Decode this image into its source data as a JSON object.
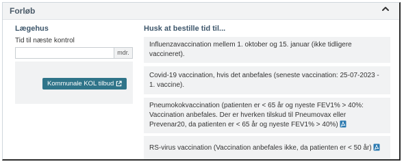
{
  "header": {
    "title": "Forløb",
    "collapse_icon": "chevron-up-icon"
  },
  "left": {
    "section_title": "Lægehus",
    "field_label": "Tid til næste kontrol",
    "input_value": "",
    "input_addon": "mdr.",
    "kol_button_label": "Kommunale KOL tilbud",
    "kol_button_icon": "external-link-icon"
  },
  "right": {
    "section_title": "Husk at bestille tid til...",
    "cards": [
      {
        "text": "Influenzavaccination mellem 1. oktober og 15. januar (ikke tidligere vaccineret)."
      },
      {
        "text": "Covid-19 vaccination, hvis det anbefales (seneste vaccination: 25-07-2023 - 1. vaccine)."
      },
      {
        "text": "Pneumokokvaccination (patienten er < 65 år og nyeste FEV1% > 40%: Vaccination anbefales. Der er hverken tilskud til Pneumovax eller Prevenar20, da patienten er < 65 år og nyeste FEV1% > 40%)",
        "icon": "pdf-icon"
      },
      {
        "text": "RS-virus vaccination (Vaccination anbefales ikke, da patienten er < 50 år)",
        "icon": "pdf-icon"
      }
    ]
  },
  "colors": {
    "header_bg": "#f2f3f4",
    "title_text": "#3d566b",
    "button_bg": "#2f7489",
    "card_bg": "#f1f2f3",
    "pdf_icon": "#2c7ab0"
  }
}
